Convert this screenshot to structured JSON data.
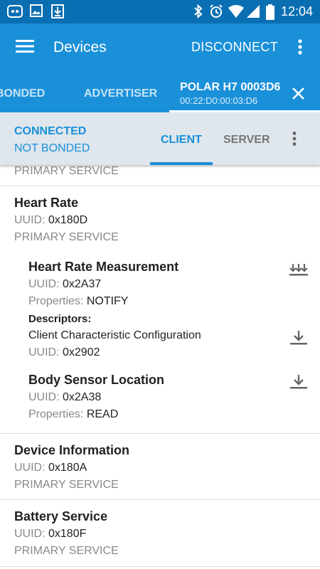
{
  "status_bar": {
    "time": "12:04"
  },
  "app_bar": {
    "title": "Devices",
    "disconnect_label": "DISCONNECT"
  },
  "top_tabs": {
    "bonded": "BONDED",
    "advertiser": "ADVERTISER",
    "device_name": "POLAR H7 0003D6",
    "device_mac": "00:22:D0:00:03:D6"
  },
  "connection": {
    "state": "CONNECTED",
    "bond": "NOT BONDED",
    "tab_client": "CLIENT",
    "tab_server": "SERVER"
  },
  "labels": {
    "uuid": "UUID:",
    "properties": "Properties:",
    "descriptors": "Descriptors:"
  },
  "services": [
    {
      "type": "PRIMARY SERVICE"
    },
    {
      "name": "Heart Rate",
      "uuid": "0x180D",
      "type": "PRIMARY SERVICE",
      "characteristics": [
        {
          "name": "Heart Rate Measurement",
          "uuid": "0x2A37",
          "properties": "NOTIFY",
          "descriptor": {
            "name": "Client Characteristic Configuration",
            "uuid": "0x2902"
          }
        },
        {
          "name": "Body Sensor Location",
          "uuid": "0x2A38",
          "properties": "READ"
        }
      ]
    },
    {
      "name": "Device Information",
      "uuid": "0x180A",
      "type": "PRIMARY SERVICE"
    },
    {
      "name": "Battery Service",
      "uuid": "0x180F",
      "type": "PRIMARY SERVICE"
    }
  ]
}
